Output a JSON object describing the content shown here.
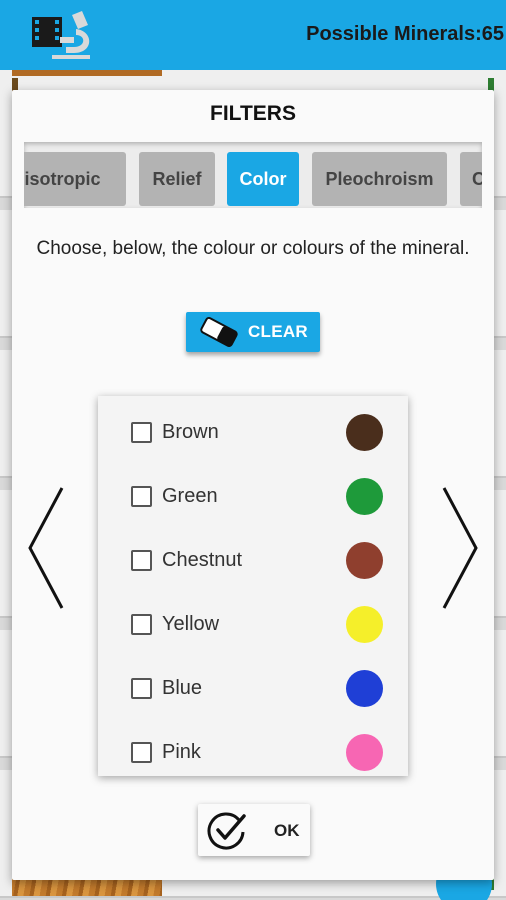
{
  "appbar": {
    "title": "Possible Minerals:65",
    "logo_icon": "microscope-film-logo-icon",
    "color": "#1aa7e4"
  },
  "dialog": {
    "title": "FILTERS",
    "tabs": [
      {
        "label": "nisotropic",
        "active": false
      },
      {
        "label": "Relief",
        "active": false
      },
      {
        "label": "Color",
        "active": true
      },
      {
        "label": "Pleochroism",
        "active": false
      },
      {
        "label": "C",
        "active": false
      }
    ],
    "instructions": "Choose, below, the colour or colours of the mineral.",
    "clear_button": {
      "label": "CLEAR",
      "icon": "eraser-icon"
    },
    "colors": [
      {
        "label": "Brown",
        "swatch": "#4a2e1c",
        "checked": false
      },
      {
        "label": "Green",
        "swatch": "#1e9a3a",
        "checked": false
      },
      {
        "label": "Chestnut",
        "swatch": "#8f3f2e",
        "checked": false
      },
      {
        "label": "Yellow",
        "swatch": "#f5ef2a",
        "checked": false
      },
      {
        "label": "Blue",
        "swatch": "#1f3fd6",
        "checked": false
      },
      {
        "label": "Pink",
        "swatch": "#f766b3",
        "checked": false
      }
    ],
    "ok_button": {
      "label": "OK",
      "icon": "check-circle-icon"
    }
  }
}
